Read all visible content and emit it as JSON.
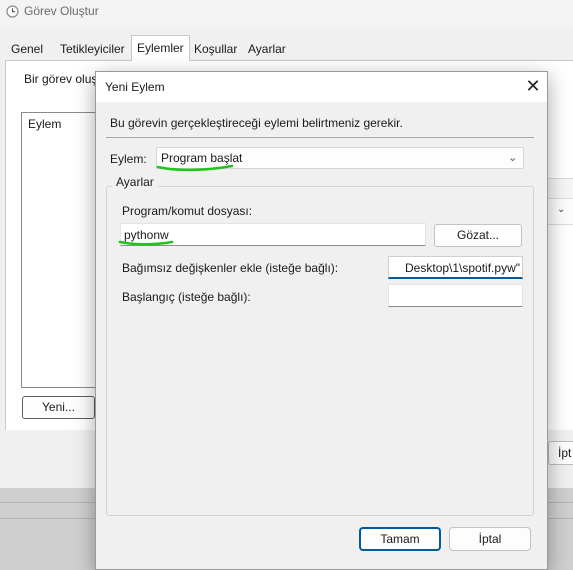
{
  "colors": {
    "accent": "#005a9e",
    "highlight_stroke": "#22c41e",
    "window_bg": "#f0f0f0"
  },
  "background_window": {
    "title": "Görev Oluştur",
    "tabs": [
      {
        "label": "Genel"
      },
      {
        "label": "Tetikleyiciler"
      },
      {
        "label": "Eylemler",
        "active": true
      },
      {
        "label": "Koşullar"
      },
      {
        "label": "Ayarlar"
      }
    ],
    "description": "Bir görev oluş",
    "list_header": "Eylem",
    "new_button": "Yeni...",
    "cancel_button_partial": "İpt"
  },
  "dialog": {
    "title": "Yeni Eylem",
    "close_icon": "close-icon",
    "intro": "Bu görevin gerçekleştireceği eylemi belirtmeniz gerekir.",
    "action_label": "Eylem:",
    "action_value": "Program başlat",
    "settings_label": "Ayarlar",
    "program_label": "Program/komut dosyası:",
    "program_value": "pythonw",
    "browse_button": "Gözat...",
    "arguments_label": "Bağımsız değişkenler ekle (isteğe bağlı):",
    "arguments_value": "Desktop\\1\\spotif.pyw\"",
    "start_in_label": "Başlangıç (isteğe bağlı):",
    "start_in_value": "",
    "ok_button": "Tamam",
    "cancel_button": "İptal"
  }
}
